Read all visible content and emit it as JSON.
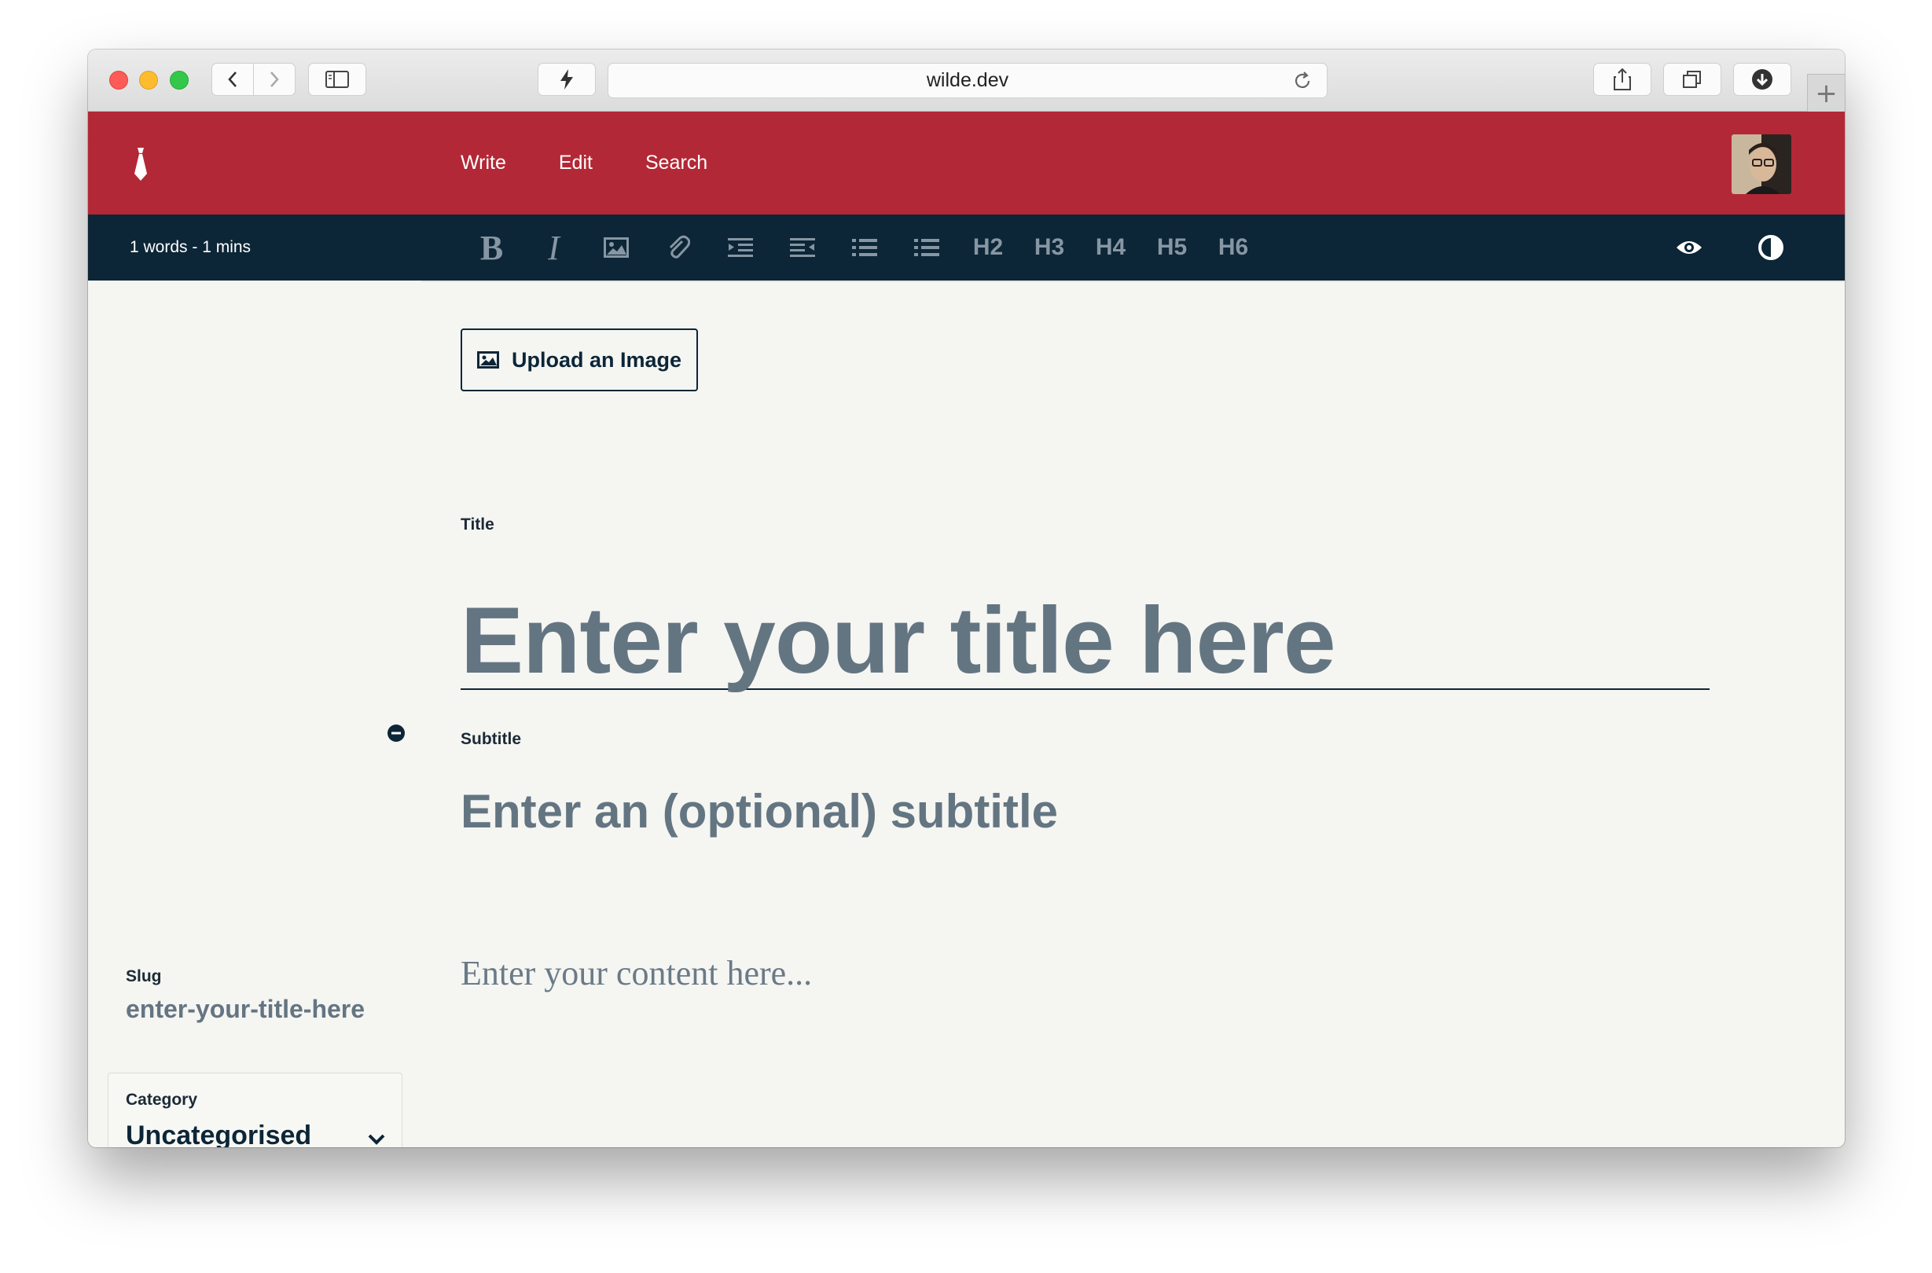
{
  "browser": {
    "url": "wilde.dev"
  },
  "header": {
    "nav": [
      "Write",
      "Edit",
      "Search"
    ]
  },
  "toolbar": {
    "word_count": "1 words - 1 mins",
    "headings": [
      "H2",
      "H3",
      "H4",
      "H5",
      "H6"
    ],
    "bold_glyph": "B",
    "italic_glyph": "I"
  },
  "editor": {
    "upload_label": "Upload an Image",
    "title_label": "Title",
    "title_placeholder": "Enter your title here",
    "subtitle_label": "Subtitle",
    "subtitle_placeholder": "Enter an (optional) subtitle",
    "content_placeholder": "Enter your content here..."
  },
  "sidebar": {
    "slug_label": "Slug",
    "slug_value": "enter-your-title-here",
    "category_label": "Category",
    "category_value": "Uncategorised"
  },
  "colors": {
    "brand_red": "#b32836",
    "toolbar_navy": "#0c2637",
    "placeholder_gray": "#647582"
  }
}
